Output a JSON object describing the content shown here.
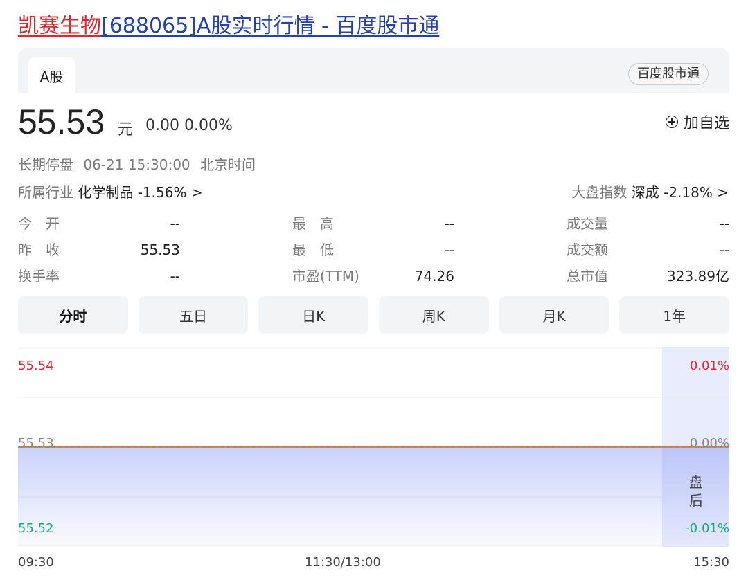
{
  "page_title": {
    "name": "凯赛生物",
    "rest": "[688065]A股实时行情 - 百度股市通"
  },
  "tabs": {
    "active": "A股",
    "source_badge": "百度股市通"
  },
  "quote": {
    "price": "55.53",
    "unit": "元",
    "change": "0.00 0.00%",
    "add_watch": "加自选"
  },
  "status": {
    "state": "长期停盘",
    "datetime": "06-21 15:30:00",
    "timezone": "北京时间"
  },
  "industry": {
    "label": "所属行业",
    "name": "化学制品",
    "change": "-1.56%",
    "arrow": ">"
  },
  "index": {
    "label": "大盘指数",
    "name": "深成",
    "change": "-2.18%",
    "arrow": ">"
  },
  "stats": [
    {
      "label": "今　开",
      "value": "--"
    },
    {
      "label": "最　高",
      "value": "--"
    },
    {
      "label": "成交量",
      "value": "--"
    },
    {
      "label": "昨　收",
      "value": "55.53"
    },
    {
      "label": "最　低",
      "value": "--"
    },
    {
      "label": "成交额",
      "value": "--"
    },
    {
      "label": "换手率",
      "value": "--"
    },
    {
      "label": "市盈(TTM)",
      "value": "74.26"
    },
    {
      "label": "总市值",
      "value": "323.89亿"
    }
  ],
  "periods": [
    "分时",
    "五日",
    "日K",
    "周K",
    "月K",
    "1年"
  ],
  "active_period": "分时",
  "colors": {
    "up": "#e0262d",
    "down": "#1aaa7a",
    "price_line": "#e8752a",
    "fill": "#5a73f0"
  },
  "chart_data": {
    "type": "line",
    "y_left_ticks": [
      "55.54",
      "55.53",
      "55.52"
    ],
    "y_right_ticks": [
      "0.01%",
      "0.00%",
      "-0.01%"
    ],
    "ylim": [
      55.52,
      55.54
    ],
    "x_ticks": [
      "09:30",
      "11:30/13:00",
      "15:30"
    ],
    "series": [
      {
        "x": [
          "09:30",
          "15:30"
        ],
        "values": [
          55.53,
          55.53
        ]
      }
    ],
    "after_hours_label": "盘后"
  }
}
